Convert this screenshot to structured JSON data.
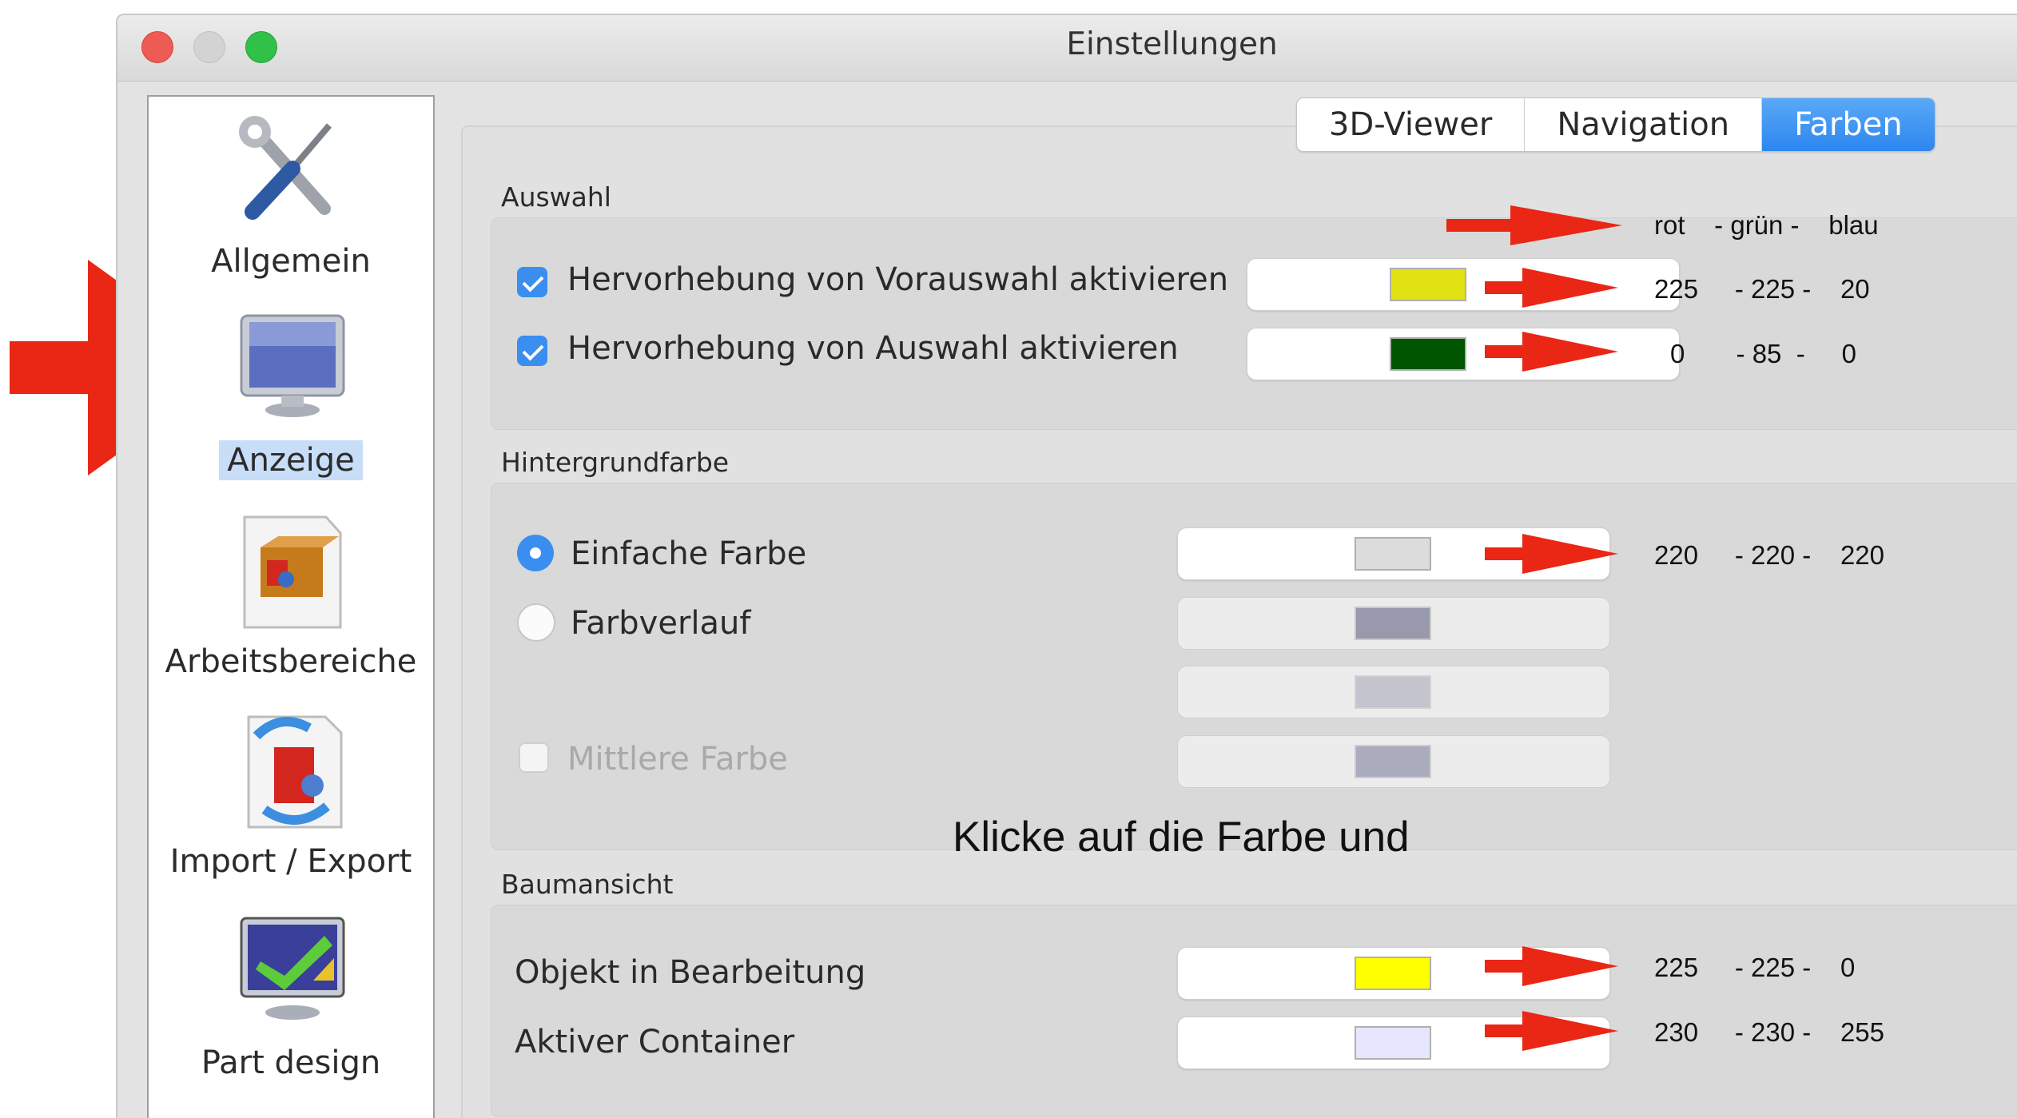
{
  "window": {
    "title": "Einstellungen",
    "traffic_lights": [
      "#ee5b54",
      "#d3d3d3",
      "#31c048"
    ]
  },
  "sidebar": {
    "items": [
      {
        "label": "Allgemein",
        "icon": "wrench-screwdriver-icon"
      },
      {
        "label": "Anzeige",
        "icon": "monitor-icon",
        "selected": true
      },
      {
        "label": "Arbeitsbereiche",
        "icon": "workbench-box-icon"
      },
      {
        "label": "Import / Export",
        "icon": "import-export-icon"
      },
      {
        "label": "Part design",
        "icon": "part-design-icon"
      }
    ]
  },
  "tabs": [
    {
      "label": "3D-Viewer"
    },
    {
      "label": "Navigation"
    },
    {
      "label": "Farben",
      "active": true
    }
  ],
  "groups": {
    "auswahl": {
      "title": "Auswahl",
      "rows": [
        {
          "label": "Hervorhebung von Vorauswahl aktivieren",
          "checked": true,
          "color": "#e1e114"
        },
        {
          "label": "Hervorhebung von Auswahl aktivieren",
          "checked": true,
          "color": "#005500"
        }
      ]
    },
    "hintergrund": {
      "title": "Hintergrundfarbe",
      "options": [
        {
          "label": "Einfache Farbe",
          "selected": true,
          "color": "#dcdcdc"
        },
        {
          "label": "Farbverlauf",
          "selected": false,
          "color": "#9999ad"
        }
      ],
      "extra_color": "#c4c4cf",
      "middle": {
        "label": "Mittlere Farbe",
        "checked": false,
        "color": "#acacbf"
      }
    },
    "baumansicht": {
      "title": "Baumansicht",
      "rows": [
        {
          "label": "Objekt in Bearbeitung",
          "color": "#ffff00"
        },
        {
          "label": "Aktiver Container",
          "color": "#e6e6ff"
        }
      ]
    }
  },
  "annotations": {
    "header": "rot    - grün -    blau",
    "values": [
      "225     - 225 -    20",
      "0       - 85  -     0",
      "220     - 220 -    220",
      "225     - 225 -    0",
      "230     - 230 -    255"
    ],
    "hint": "Klicke auf die Farbe und",
    "arrow_color": "#ea2615"
  }
}
